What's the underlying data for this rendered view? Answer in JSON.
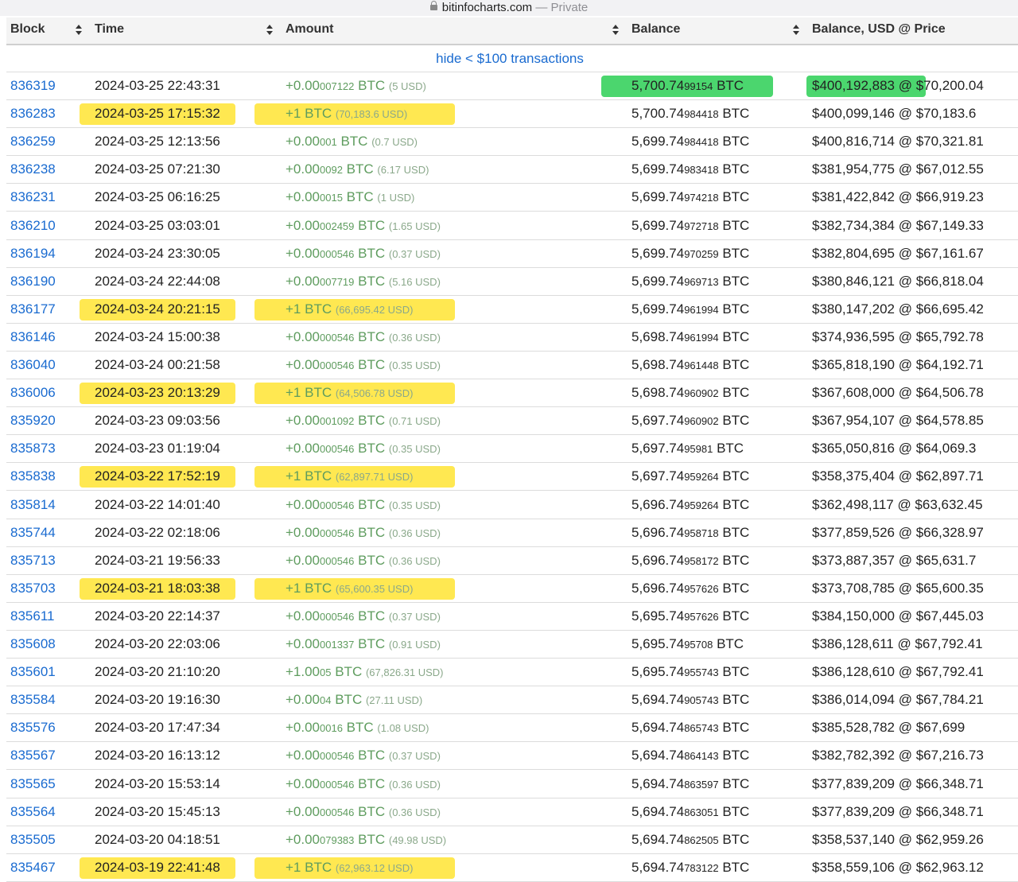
{
  "browser": {
    "domain": "bitinfocharts.com",
    "separator": " — ",
    "mode": "Private"
  },
  "table": {
    "columns": [
      "Block",
      "Time",
      "Amount",
      "Balance",
      "Balance, USD @ Price"
    ],
    "hide_link": "hide < $100 transactions",
    "rows": [
      {
        "block": "836319",
        "time": "2024-03-25 22:43:31",
        "amt_main": "+0.00",
        "amt_small": "007122",
        "amt_usd": "(5 USD)",
        "bal_main": "5,700.74",
        "bal_small": "99154",
        "usd": "$400,192,883 @ $70,200.04",
        "highlight": "green"
      },
      {
        "block": "836283",
        "time": "2024-03-25 17:15:32",
        "amt_main": "+1",
        "amt_small": "",
        "amt_usd": "(70,183.6 USD)",
        "bal_main": "5,700.74",
        "bal_small": "984418",
        "usd": "$400,099,146 @ $70,183.6",
        "highlight": "yellow"
      },
      {
        "block": "836259",
        "time": "2024-03-25 12:13:56",
        "amt_main": "+0.00",
        "amt_small": "001",
        "amt_usd": "(0.7 USD)",
        "bal_main": "5,699.74",
        "bal_small": "984418",
        "usd": "$400,816,714 @ $70,321.81",
        "highlight": ""
      },
      {
        "block": "836238",
        "time": "2024-03-25 07:21:30",
        "amt_main": "+0.00",
        "amt_small": "0092",
        "amt_usd": "(6.17 USD)",
        "bal_main": "5,699.74",
        "bal_small": "983418",
        "usd": "$381,954,775 @ $67,012.55",
        "highlight": ""
      },
      {
        "block": "836231",
        "time": "2024-03-25 06:16:25",
        "amt_main": "+0.00",
        "amt_small": "0015",
        "amt_usd": "(1 USD)",
        "bal_main": "5,699.74",
        "bal_small": "974218",
        "usd": "$381,422,842 @ $66,919.23",
        "highlight": ""
      },
      {
        "block": "836210",
        "time": "2024-03-25 03:03:01",
        "amt_main": "+0.00",
        "amt_small": "002459",
        "amt_usd": "(1.65 USD)",
        "bal_main": "5,699.74",
        "bal_small": "972718",
        "usd": "$382,734,384 @ $67,149.33",
        "highlight": ""
      },
      {
        "block": "836194",
        "time": "2024-03-24 23:30:05",
        "amt_main": "+0.00",
        "amt_small": "000546",
        "amt_usd": "(0.37 USD)",
        "bal_main": "5,699.74",
        "bal_small": "970259",
        "usd": "$382,804,695 @ $67,161.67",
        "highlight": ""
      },
      {
        "block": "836190",
        "time": "2024-03-24 22:44:08",
        "amt_main": "+0.00",
        "amt_small": "007719",
        "amt_usd": "(5.16 USD)",
        "bal_main": "5,699.74",
        "bal_small": "969713",
        "usd": "$380,846,121 @ $66,818.04",
        "highlight": ""
      },
      {
        "block": "836177",
        "time": "2024-03-24 20:21:15",
        "amt_main": "+1",
        "amt_small": "",
        "amt_usd": "(66,695.42 USD)",
        "bal_main": "5,699.74",
        "bal_small": "961994",
        "usd": "$380,147,202 @ $66,695.42",
        "highlight": "yellow"
      },
      {
        "block": "836146",
        "time": "2024-03-24 15:00:38",
        "amt_main": "+0.00",
        "amt_small": "000546",
        "amt_usd": "(0.36 USD)",
        "bal_main": "5,698.74",
        "bal_small": "961994",
        "usd": "$374,936,595 @ $65,792.78",
        "highlight": ""
      },
      {
        "block": "836040",
        "time": "2024-03-24 00:21:58",
        "amt_main": "+0.00",
        "amt_small": "000546",
        "amt_usd": "(0.35 USD)",
        "bal_main": "5,698.74",
        "bal_small": "961448",
        "usd": "$365,818,190 @ $64,192.71",
        "highlight": ""
      },
      {
        "block": "836006",
        "time": "2024-03-23 20:13:29",
        "amt_main": "+1",
        "amt_small": "",
        "amt_usd": "(64,506.78 USD)",
        "bal_main": "5,698.74",
        "bal_small": "960902",
        "usd": "$367,608,000 @ $64,506.78",
        "highlight": "yellow"
      },
      {
        "block": "835920",
        "time": "2024-03-23 09:03:56",
        "amt_main": "+0.00",
        "amt_small": "001092",
        "amt_usd": "(0.71 USD)",
        "bal_main": "5,697.74",
        "bal_small": "960902",
        "usd": "$367,954,107 @ $64,578.85",
        "highlight": ""
      },
      {
        "block": "835873",
        "time": "2024-03-23 01:19:04",
        "amt_main": "+0.00",
        "amt_small": "000546",
        "amt_usd": "(0.35 USD)",
        "bal_main": "5,697.74",
        "bal_small": "95981",
        "usd": "$365,050,816 @ $64,069.3",
        "highlight": ""
      },
      {
        "block": "835838",
        "time": "2024-03-22 17:52:19",
        "amt_main": "+1",
        "amt_small": "",
        "amt_usd": "(62,897.71 USD)",
        "bal_main": "5,697.74",
        "bal_small": "959264",
        "usd": "$358,375,404 @ $62,897.71",
        "highlight": "yellow"
      },
      {
        "block": "835814",
        "time": "2024-03-22 14:01:40",
        "amt_main": "+0.00",
        "amt_small": "000546",
        "amt_usd": "(0.35 USD)",
        "bal_main": "5,696.74",
        "bal_small": "959264",
        "usd": "$362,498,117 @ $63,632.45",
        "highlight": ""
      },
      {
        "block": "835744",
        "time": "2024-03-22 02:18:06",
        "amt_main": "+0.00",
        "amt_small": "000546",
        "amt_usd": "(0.36 USD)",
        "bal_main": "5,696.74",
        "bal_small": "958718",
        "usd": "$377,859,526 @ $66,328.97",
        "highlight": ""
      },
      {
        "block": "835713",
        "time": "2024-03-21 19:56:33",
        "amt_main": "+0.00",
        "amt_small": "000546",
        "amt_usd": "(0.36 USD)",
        "bal_main": "5,696.74",
        "bal_small": "958172",
        "usd": "$373,887,357 @ $65,631.7",
        "highlight": ""
      },
      {
        "block": "835703",
        "time": "2024-03-21 18:03:38",
        "amt_main": "+1",
        "amt_small": "",
        "amt_usd": "(65,600.35 USD)",
        "bal_main": "5,696.74",
        "bal_small": "957626",
        "usd": "$373,708,785 @ $65,600.35",
        "highlight": "yellow"
      },
      {
        "block": "835611",
        "time": "2024-03-20 22:14:37",
        "amt_main": "+0.00",
        "amt_small": "000546",
        "amt_usd": "(0.37 USD)",
        "bal_main": "5,695.74",
        "bal_small": "957626",
        "usd": "$384,150,000 @ $67,445.03",
        "highlight": ""
      },
      {
        "block": "835608",
        "time": "2024-03-20 22:03:06",
        "amt_main": "+0.00",
        "amt_small": "001337",
        "amt_usd": "(0.91 USD)",
        "bal_main": "5,695.74",
        "bal_small": "95708",
        "usd": "$386,128,611 @ $67,792.41",
        "highlight": ""
      },
      {
        "block": "835601",
        "time": "2024-03-20 21:10:20",
        "amt_main": "+1.00",
        "amt_small": "05",
        "amt_usd": "(67,826.31 USD)",
        "bal_main": "5,695.74",
        "bal_small": "955743",
        "usd": "$386,128,610 @ $67,792.41",
        "highlight": ""
      },
      {
        "block": "835584",
        "time": "2024-03-20 19:16:30",
        "amt_main": "+0.00",
        "amt_small": "04",
        "amt_usd": "(27.11 USD)",
        "bal_main": "5,694.74",
        "bal_small": "905743",
        "usd": "$386,014,094 @ $67,784.21",
        "highlight": ""
      },
      {
        "block": "835576",
        "time": "2024-03-20 17:47:34",
        "amt_main": "+0.00",
        "amt_small": "0016",
        "amt_usd": "(1.08 USD)",
        "bal_main": "5,694.74",
        "bal_small": "865743",
        "usd": "$385,528,782 @ $67,699",
        "highlight": ""
      },
      {
        "block": "835567",
        "time": "2024-03-20 16:13:12",
        "amt_main": "+0.00",
        "amt_small": "000546",
        "amt_usd": "(0.37 USD)",
        "bal_main": "5,694.74",
        "bal_small": "864143",
        "usd": "$382,782,392 @ $67,216.73",
        "highlight": ""
      },
      {
        "block": "835565",
        "time": "2024-03-20 15:53:14",
        "amt_main": "+0.00",
        "amt_small": "000546",
        "amt_usd": "(0.36 USD)",
        "bal_main": "5,694.74",
        "bal_small": "863597",
        "usd": "$377,839,209 @ $66,348.71",
        "highlight": ""
      },
      {
        "block": "835564",
        "time": "2024-03-20 15:45:13",
        "amt_main": "+0.00",
        "amt_small": "000546",
        "amt_usd": "(0.36 USD)",
        "bal_main": "5,694.74",
        "bal_small": "863051",
        "usd": "$377,839,209 @ $66,348.71",
        "highlight": ""
      },
      {
        "block": "835505",
        "time": "2024-03-20 04:18:51",
        "amt_main": "+0.00",
        "amt_small": "079383",
        "amt_usd": "(49.98 USD)",
        "bal_main": "5,694.74",
        "bal_small": "862505",
        "usd": "$358,537,140 @ $62,959.26",
        "highlight": ""
      },
      {
        "block": "835467",
        "time": "2024-03-19 22:41:48",
        "amt_main": "+1",
        "amt_small": "",
        "amt_usd": "(62,963.12 USD)",
        "bal_main": "5,694.74",
        "bal_small": "783122",
        "usd": "$358,559,106 @ $62,963.12",
        "highlight": "yellow"
      }
    ],
    "unit": "BTC"
  },
  "colors": {
    "link": "#1a6bd0",
    "amount": "#5e9c5e",
    "highlight_yellow": "#ffe433",
    "highlight_green": "#37d25e"
  }
}
